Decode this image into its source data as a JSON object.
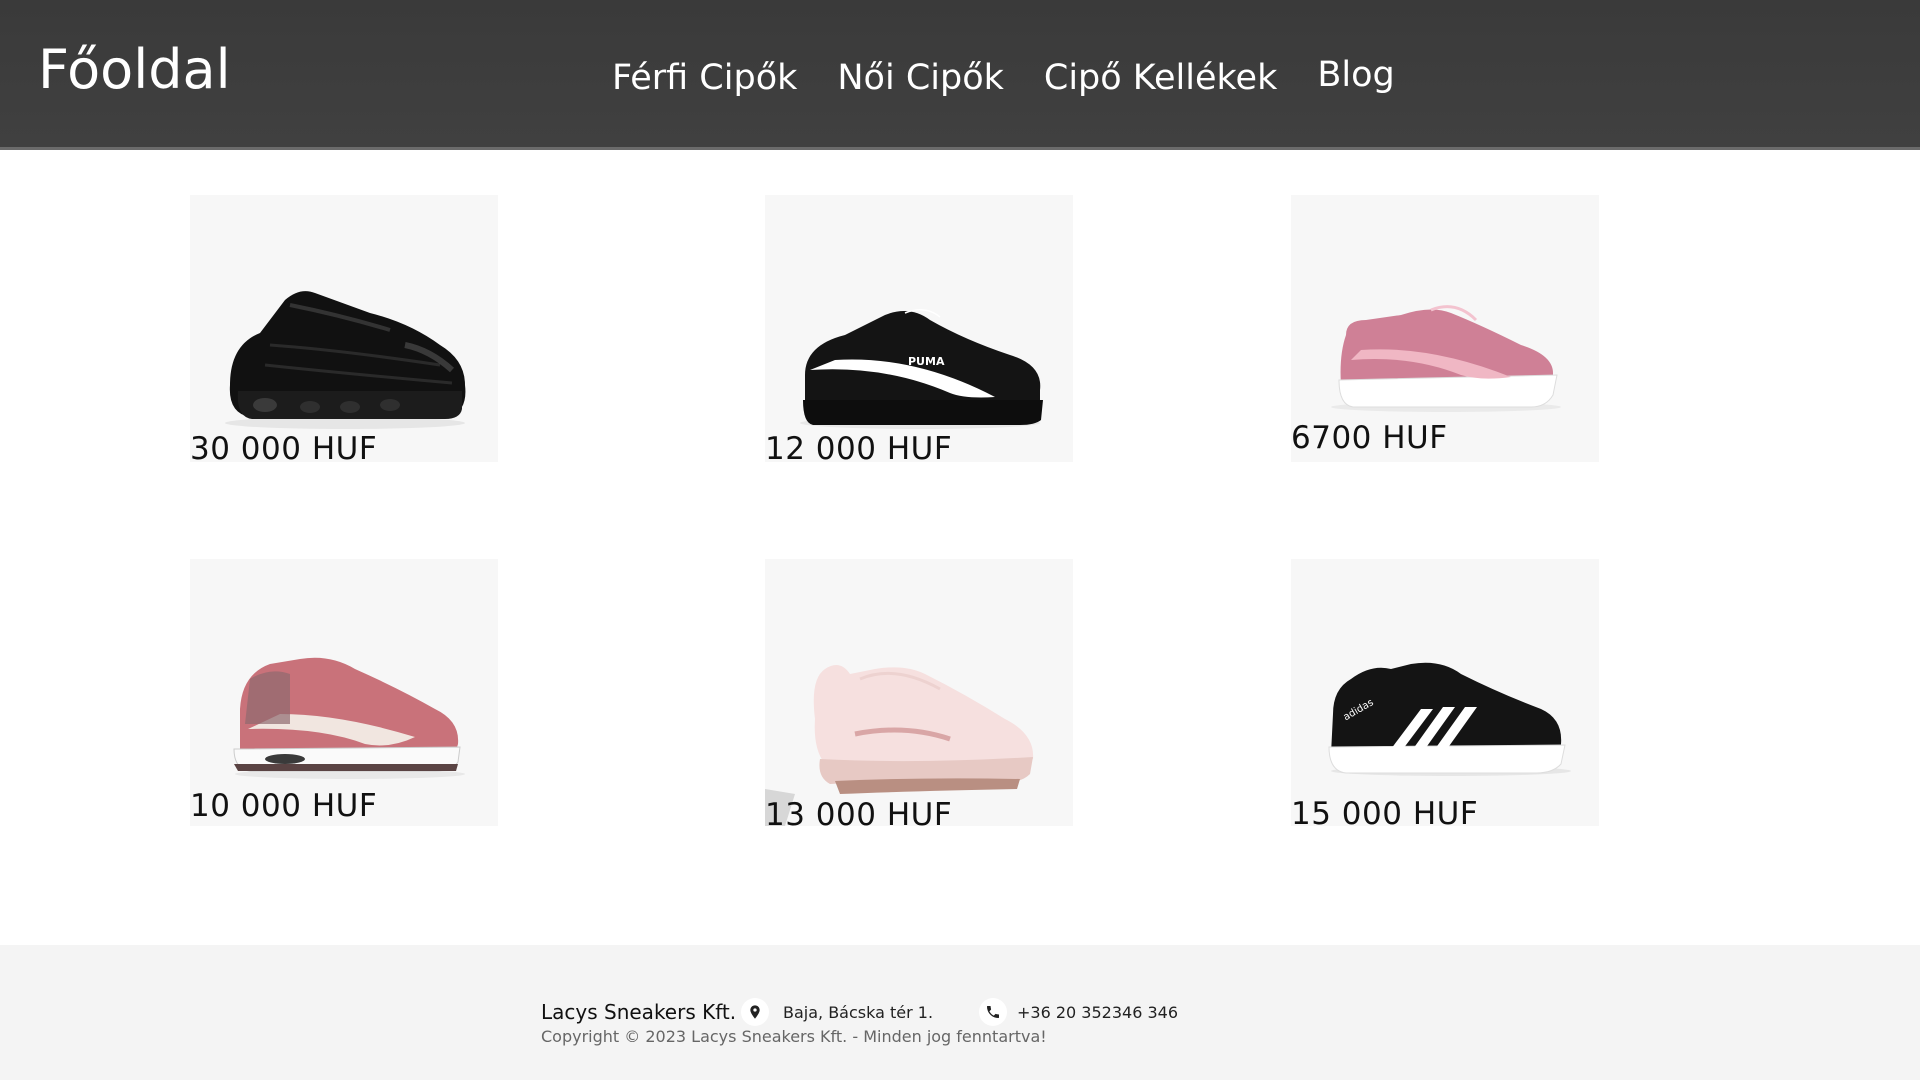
{
  "header": {
    "brand": "Főoldal",
    "nav": [
      {
        "label": "Férfi Cipők"
      },
      {
        "label": "Női Cipők"
      },
      {
        "label": "Cipő Kellékek"
      },
      {
        "label": "Blog"
      }
    ]
  },
  "products": [
    {
      "price": "30 000 HUF",
      "icon": "black-air-max-sneaker"
    },
    {
      "price": "12 000 HUF",
      "icon": "black-puma-sneaker"
    },
    {
      "price": "6700 HUF",
      "icon": "pink-glitter-puma-sneaker"
    },
    {
      "price": "10 000 HUF",
      "icon": "pink-nike-air-max-sneaker"
    },
    {
      "price": "13 000 HUF",
      "icon": "light-pink-nike-sneaker"
    },
    {
      "price": "15 000 HUF",
      "icon": "black-adidas-sneaker"
    }
  ],
  "footer": {
    "company": "Lacys Sneakers Kft.",
    "address": "Baja, Bácska tér 1.",
    "phone": "+36 20 352346 346",
    "copyright": "Copyright © 2023 Lacys Sneakers Kft. - Minden jog fenntartva!"
  },
  "colors": {
    "header_bg": "#3c3c3c",
    "footer_bg": "#f4f4f4",
    "card_bg": "#f7f7f7"
  }
}
